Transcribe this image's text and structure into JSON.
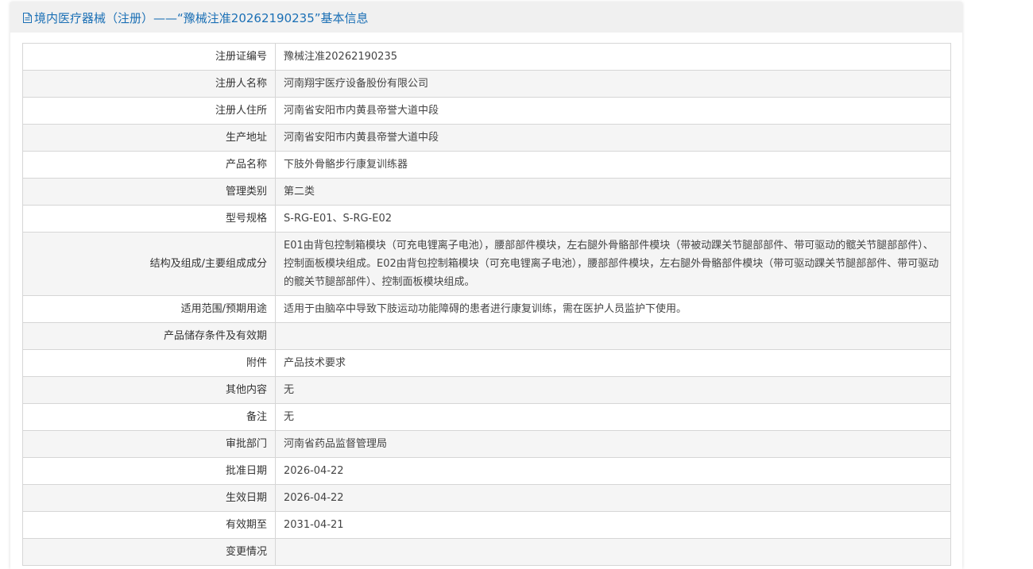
{
  "header": {
    "title": "境内医疗器械（注册）——“豫械注准20262190235”基本信息",
    "icon": "document-icon"
  },
  "rows": [
    {
      "label": "注册证编号",
      "value": "豫械注准20262190235"
    },
    {
      "label": "注册人名称",
      "value": "河南翔宇医疗设备股份有限公司"
    },
    {
      "label": "注册人住所",
      "value": "河南省安阳市内黄县帝誉大道中段"
    },
    {
      "label": "生产地址",
      "value": "河南省安阳市内黄县帝誉大道中段"
    },
    {
      "label": "产品名称",
      "value": "下肢外骨骼步行康复训练器"
    },
    {
      "label": "管理类别",
      "value": "第二类"
    },
    {
      "label": "型号规格",
      "value": "S-RG-E01、S-RG-E02"
    },
    {
      "label": "结构及组成/主要组成成分",
      "value": "E01由背包控制箱模块（可充电锂离子电池），腰部部件模块，左右腿外骨骼部件模块（带被动踝关节腿部部件、带可驱动的髋关节腿部部件）、控制面板模块组成。E02由背包控制箱模块（可充电锂离子电池），腰部部件模块，左右腿外骨骼部件模块（带可驱动踝关节腿部部件、带可驱动的髋关节腿部部件）、控制面板模块组成。"
    },
    {
      "label": "适用范围/预期用途",
      "value": "适用于由脑卒中导致下肢运动功能障碍的患者进行康复训练，需在医护人员监护下使用。"
    },
    {
      "label": "产品储存条件及有效期",
      "value": ""
    },
    {
      "label": "附件",
      "value": "产品技术要求"
    },
    {
      "label": "其他内容",
      "value": "无"
    },
    {
      "label": "备注",
      "value": "无"
    },
    {
      "label": "审批部门",
      "value": "河南省药品监督管理局"
    },
    {
      "label": "批准日期",
      "value": "2026-04-22"
    },
    {
      "label": "生效日期",
      "value": "2026-04-22"
    },
    {
      "label": "有效期至",
      "value": "2031-04-21"
    },
    {
      "label": "变更情况",
      "value": ""
    }
  ]
}
